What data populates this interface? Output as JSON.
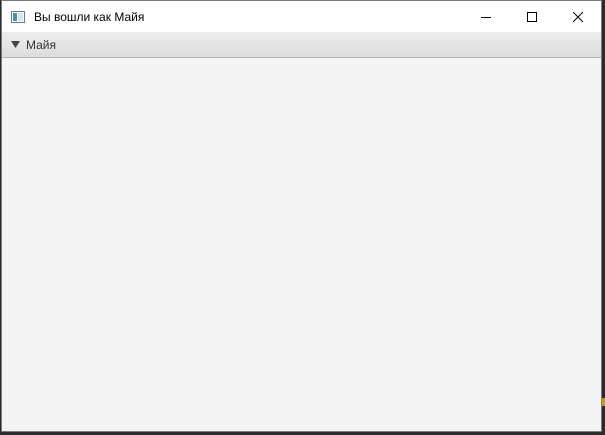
{
  "window": {
    "title": "Вы вошли как Майя",
    "controls": {
      "minimize_icon": "minimize-icon",
      "maximize_icon": "maximize-icon",
      "close_icon": "close-icon"
    }
  },
  "titled_pane": {
    "label": "Майя",
    "expanded": true
  },
  "colors": {
    "titlebar": "#ffffff",
    "content": "#f4f4f4",
    "header_gradient_top": "#eeeeee",
    "header_gradient_bottom": "#dcdcdc"
  }
}
